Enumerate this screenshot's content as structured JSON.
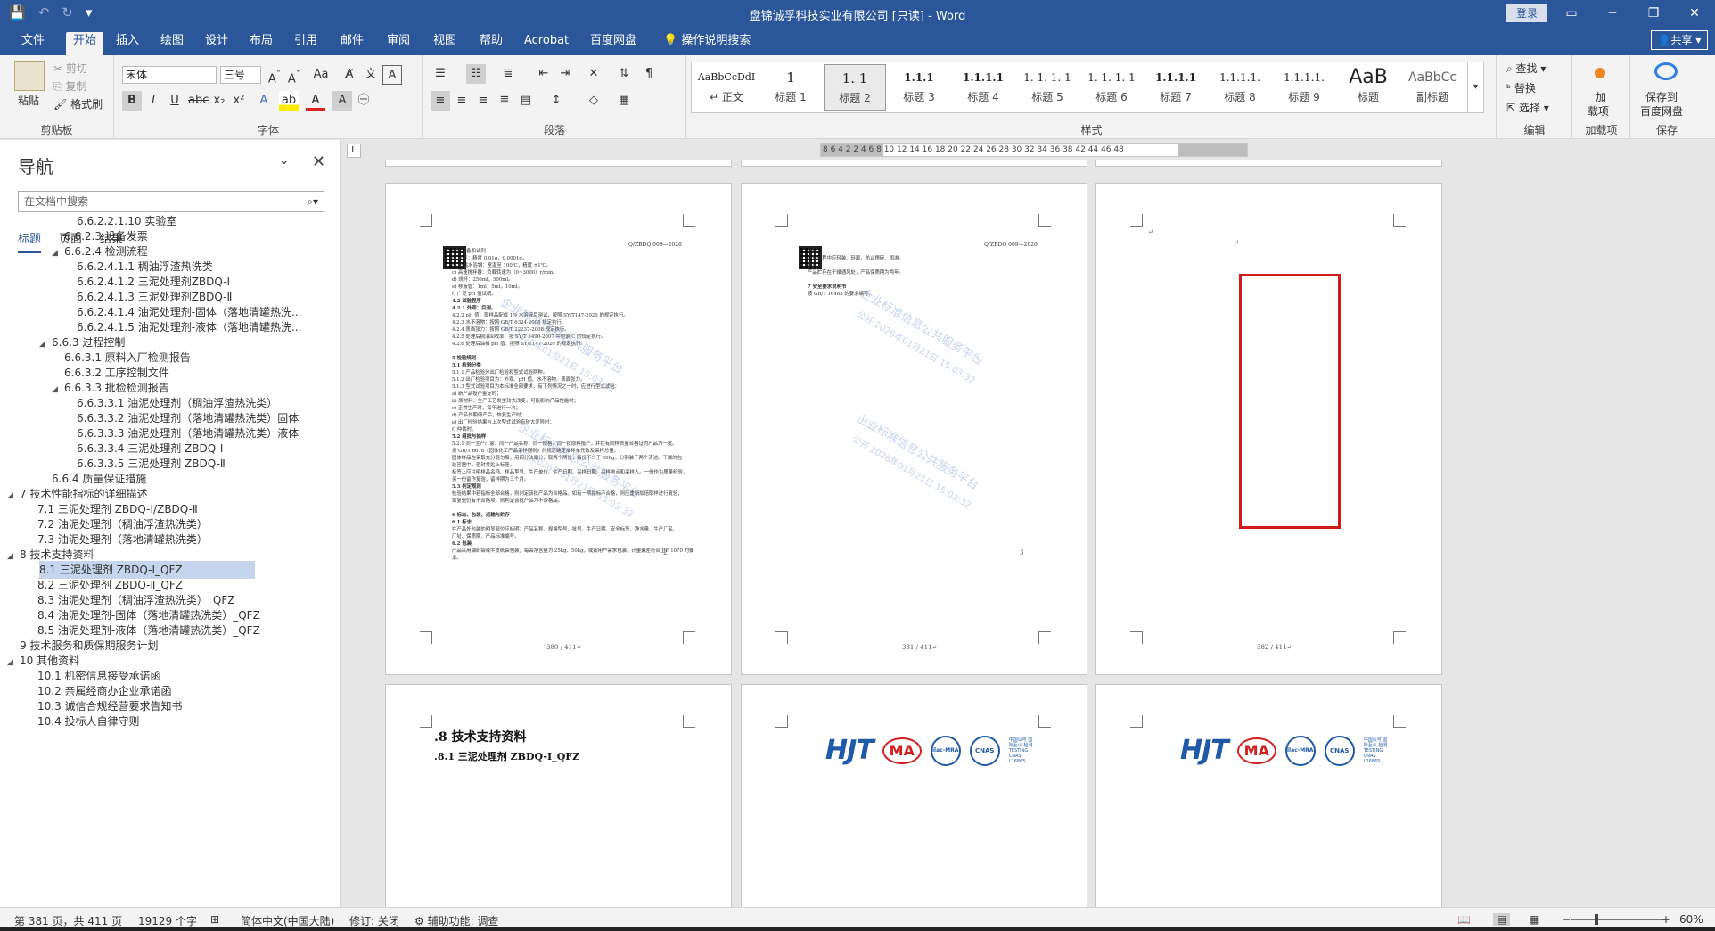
{
  "window": {
    "title": "盘锦诚孚科技实业有限公司 [只读] - Word",
    "login": "登录",
    "minimize": "─",
    "restore": "❐",
    "close": "✕",
    "ribbon_display": "▭"
  },
  "qat": {
    "save": "💾",
    "undo": "↶",
    "redo": "↻",
    "customize": "▾"
  },
  "tabs": [
    "文件",
    "开始",
    "插入",
    "绘图",
    "设计",
    "布局",
    "引用",
    "邮件",
    "审阅",
    "视图",
    "帮助",
    "Acrobat",
    "百度网盘"
  ],
  "active_tab": "开始",
  "tell_me": "操作说明搜索",
  "share": "共享",
  "ribbon": {
    "clipboard": {
      "paste": "粘贴",
      "cut": "剪切",
      "copy": "复制",
      "format_painter": "格式刷",
      "label": "剪贴板"
    },
    "font": {
      "name": "宋体",
      "size": "三号",
      "label": "字体"
    },
    "paragraph": {
      "label": "段落"
    },
    "styles": {
      "label": "样式",
      "items": [
        {
          "preview": "AaBbCcDdI",
          "name": "↵ 正文"
        },
        {
          "preview": "1",
          "name": "标题 1"
        },
        {
          "preview": "1. 1",
          "name": "标题 2"
        },
        {
          "preview": "1.1.1",
          "name": "标题 3"
        },
        {
          "preview": "1.1.1.1",
          "name": "标题 4"
        },
        {
          "preview": "1. 1. 1. 1",
          "name": "标题 5"
        },
        {
          "preview": "1. 1. 1. 1",
          "name": "标题 6"
        },
        {
          "preview": "1.1.1.1",
          "name": "标题 7"
        },
        {
          "preview": "1.1.1.1.",
          "name": "标题 8"
        },
        {
          "preview": "1.1.1.1.",
          "name": "标题 9"
        },
        {
          "preview": "AaB",
          "name": "标题"
        },
        {
          "preview": "AaBbCc",
          "name": "副标题"
        }
      ],
      "selected_index": 2
    },
    "editing": {
      "find": "查找",
      "replace": "替换",
      "select": "选择",
      "label": "编辑"
    },
    "addins": {
      "btn1": "加",
      "btn2": "载项",
      "label": "加载项"
    },
    "save_group": {
      "btn1": "保存到",
      "btn2": "百度网盘",
      "label": "保存"
    }
  },
  "nav": {
    "title": "导航",
    "search_placeholder": "在文档中搜索",
    "tabs": [
      "标题",
      "页面",
      "结果"
    ],
    "active_tab": "标题",
    "items": [
      {
        "text": "6.6.2.2.1.10 实验室",
        "level": 6,
        "arrow": ""
      },
      {
        "text": "6.6.2.3 设备发票",
        "level": 4,
        "arrow": ""
      },
      {
        "text": "6.6.2.4 检测流程",
        "level": 4,
        "arrow": "◢"
      },
      {
        "text": "6.6.2.4.1.1 稠油浮渣热洗类",
        "level": 5,
        "arrow": ""
      },
      {
        "text": "6.6.2.4.1.2 三泥处理剂ZBDQ-Ⅰ",
        "level": 6,
        "arrow": ""
      },
      {
        "text": "6.6.2.4.1.3 三泥处理剂ZBDQ-Ⅱ",
        "level": 6,
        "arrow": ""
      },
      {
        "text": "6.6.2.4.1.4 油泥处理剂-固体（落地清罐热洗...",
        "level": 6,
        "arrow": ""
      },
      {
        "text": "6.6.2.4.1.5 油泥处理剂-液体（落地清罐热洗...",
        "level": 6,
        "arrow": ""
      },
      {
        "text": "6.6.3 过程控制",
        "level": 3,
        "arrow": "◢"
      },
      {
        "text": "6.6.3.1 原料入厂检测报告",
        "level": 4,
        "arrow": ""
      },
      {
        "text": "6.6.3.2 工序控制文件",
        "level": 4,
        "arrow": ""
      },
      {
        "text": "6.6.3.3 批检检测报告",
        "level": 4,
        "arrow": "◢"
      },
      {
        "text": "6.6.3.3.1 油泥处理剂（稠油浮渣热洗类）",
        "level": 5,
        "arrow": ""
      },
      {
        "text": "6.6.3.3.2 油泥处理剂（落地清罐热洗类）固体",
        "level": 5,
        "arrow": ""
      },
      {
        "text": "6.6.3.3.3 油泥处理剂（落地清罐热洗类）液体",
        "level": 5,
        "arrow": ""
      },
      {
        "text": "6.6.3.3.4 三泥处理剂 ZBDQ-Ⅰ",
        "level": 5,
        "arrow": ""
      },
      {
        "text": "6.6.3.3.5 三泥处理剂 ZBDQ-Ⅱ",
        "level": 5,
        "arrow": ""
      },
      {
        "text": "6.6.4 质量保证措施",
        "level": 3,
        "arrow": ""
      },
      {
        "text": "7 技术性能指标的详细描述",
        "level": 1,
        "arrow": "◢"
      },
      {
        "text": "7.1 三泥处理剂 ZBDQ-Ⅰ/ZBDQ-Ⅱ",
        "level": 2,
        "arrow": ""
      },
      {
        "text": "7.2 油泥处理剂（稠油浮渣热洗类）",
        "level": 2,
        "arrow": ""
      },
      {
        "text": "7.3 油泥处理剂（落地清罐热洗类）",
        "level": 2,
        "arrow": ""
      },
      {
        "text": "8 技术支持资料",
        "level": 1,
        "arrow": "◢"
      },
      {
        "text": "8.1 三泥处理剂 ZBDQ-Ⅰ_QFZ",
        "level": 2,
        "arrow": "",
        "selected": true
      },
      {
        "text": "8.2 三泥处理剂 ZBDQ-Ⅱ_QFZ",
        "level": 2,
        "arrow": ""
      },
      {
        "text": "8.3 油泥处理剂（稠油浮渣热洗类）_QFZ",
        "level": 2,
        "arrow": ""
      },
      {
        "text": "8.4 油泥处理剂-固体（落地清罐热洗类）_QFZ",
        "level": 2,
        "arrow": ""
      },
      {
        "text": "8.5 油泥处理剂-液体（落地清罐热洗类）_QFZ",
        "level": 2,
        "arrow": ""
      },
      {
        "text": "9 技术服务和质保期服务计划",
        "level": 1,
        "arrow": ""
      },
      {
        "text": "10 其他资料",
        "level": 1,
        "arrow": "◢"
      },
      {
        "text": "10.1 机密信息接受承诺函",
        "level": 2,
        "arrow": ""
      },
      {
        "text": "10.2 亲属经商办企业承诺函",
        "level": 2,
        "arrow": ""
      },
      {
        "text": "10.3 诚信合规经营要求告知书",
        "level": 2,
        "arrow": ""
      },
      {
        "text": "10.4 投标人自律守则",
        "level": 2,
        "arrow": ""
      }
    ]
  },
  "ruler": {
    "ticks": "8  6  4  2     2  4  6  8 10 12 14 16 18 20 22 24 26 28 30 32 34 36 38     42 44 46 48",
    "corner": "L"
  },
  "pages": {
    "p380": {
      "header_code": "Q/ZBDQ 009—2026",
      "lines": [
        "仪器设备和试剂",
        "a) 天平：精度 0.01g，0.0001g。",
        "b) 恒温水浴锅：室温至 100℃，精度 ±1℃。",
        "c) 高速搅拌器：负载转速为（0~3000）r/min。",
        "d) 烧杯：250ml，500ml。",
        "e) 移液管：1ml，5ml，10ml。",
        "f) 广泛 pH 值试纸。",
        "4.2 试验程序",
        "4.2.1 外观：目测。",
        "4.2.2 pH 值：取样品配成 1% 水溶液后测试，按照 SY/T147-2020 的规定执行。",
        "4.2.3 水不溶物：按照 GB/T 6324-2008 规定执行。",
        "4.2.4 表面张力：按照 GB/T 22237-2008 规定执行。",
        "4.2.5 处理后稠油回收率：按 SY/T 5490-2007 中附录 C 的规定执行。",
        "4.2.6 处理后油相 pH 值：按照 SY/T147-2020 的规定执行。",
        "",
        "5 检验规则",
        "5.1 检验分类",
        "5.1.1 产品检验分出厂检验和型式试验两种。",
        "5.1.2 出厂检验项目为：外观、pH 值、水不溶物、表面张力。",
        "5.1.3 型式试验项目为本标准全部要求，有下列情况之一时，应进行型式试验：",
        "a) 新产品投产鉴定时；",
        "b) 原材料、生产工艺发生较大改变，可能影响产品性能时；",
        "c) 正常生产时，每年进行一次；",
        "d) 产品长期停产后，恢复生产时；",
        "e) 出厂检验结果与上次型式试验有较大差异时；",
        "f) 仲裁时。",
        "5.2 组批与抽样",
        "5.2.1 同一生产厂家、同一产品名称、同一规格、同一批原料投产，并在有同样质量合格证的产品为一批。",
        "按 GB/T 6678《固体化工产品采样通则》的规定确定抽样单元数及采样总量。",
        "固体样品在采取充分混匀后，用四分法缩分，取两个两份，每份不少于 500g，分别装于两个清洁、干燥的包",
        "装容器中，密封并贴上标签。",
        "标签上应注明样品名称、样品型号、生产单位、生产日期、采样日期、采样地点和采样人。一份作为质量检验，",
        "另一份留作复验，留样期为三个月。",
        "5.3 判定规则",
        "检验结果中若指标全部合格，则判定该批产品为合格品。如有一项指标不合格，则应重新加倍取样进行复验，",
        "如复验仍有不合格项，则判定该批产品为不合格品。",
        "",
        "6 标志、包装、运输与贮存",
        "6.1 标志",
        "在产品外包装的明显部位应标明：产品名称、规格型号、批号、生产日期、安全标签、净含量、生产厂名、",
        "厂址、保质期、产品标准编号。",
        "6.2 包装",
        "产品采用编织袋或牛皮纸袋包装，每袋净含量为 25kg、50kg，或按用户需求包装。计量偏差符合 JJF 1070 的要",
        "求。"
      ],
      "small_pnum": "2",
      "footer": "380 / 411↵"
    },
    "p381": {
      "header_code": "Q/ZBDQ 009—2026",
      "lines": [
        "运输",
        "运输过程中应轻装、轻卸，防止撞碎、雨淋。",
        "贮存",
        "产品贮存在干燥通风处，产品保质期为两年。",
        "",
        "7 安全要求说明书",
        "按 GB/T 16483 的要求编写。"
      ],
      "small_pnum": "3",
      "footer": "381 / 411↵"
    },
    "p382": {
      "mark1": "↵",
      "mark2": "↵",
      "footer": "382 / 411↵"
    },
    "watermark_line1": "企业标准信息公共服务平台",
    "watermark_line2": "公开    2026年01月21日 15:03:32",
    "p383": {
      "heading1": ".8  技术支持资料",
      "heading2": ".8.1 三泥处理剂 ZBDQ-Ⅰ_QFZ",
      "pilcrow": "↵"
    },
    "logos": {
      "hjt": "HJT",
      "ma": "MA",
      "ilac": "ilac-MRA",
      "cnas": "CNAS",
      "cnas_sub": "中国认可 国际互认 检测 TESTING CNAS L16865"
    }
  },
  "status": {
    "page": "第 381 页，共 411 页",
    "words": "19129 个字",
    "lang": "简体中文(中国大陆)",
    "track": "修订: 关闭",
    "accessibility": "辅助功能: 调查",
    "zoom": "60%"
  }
}
